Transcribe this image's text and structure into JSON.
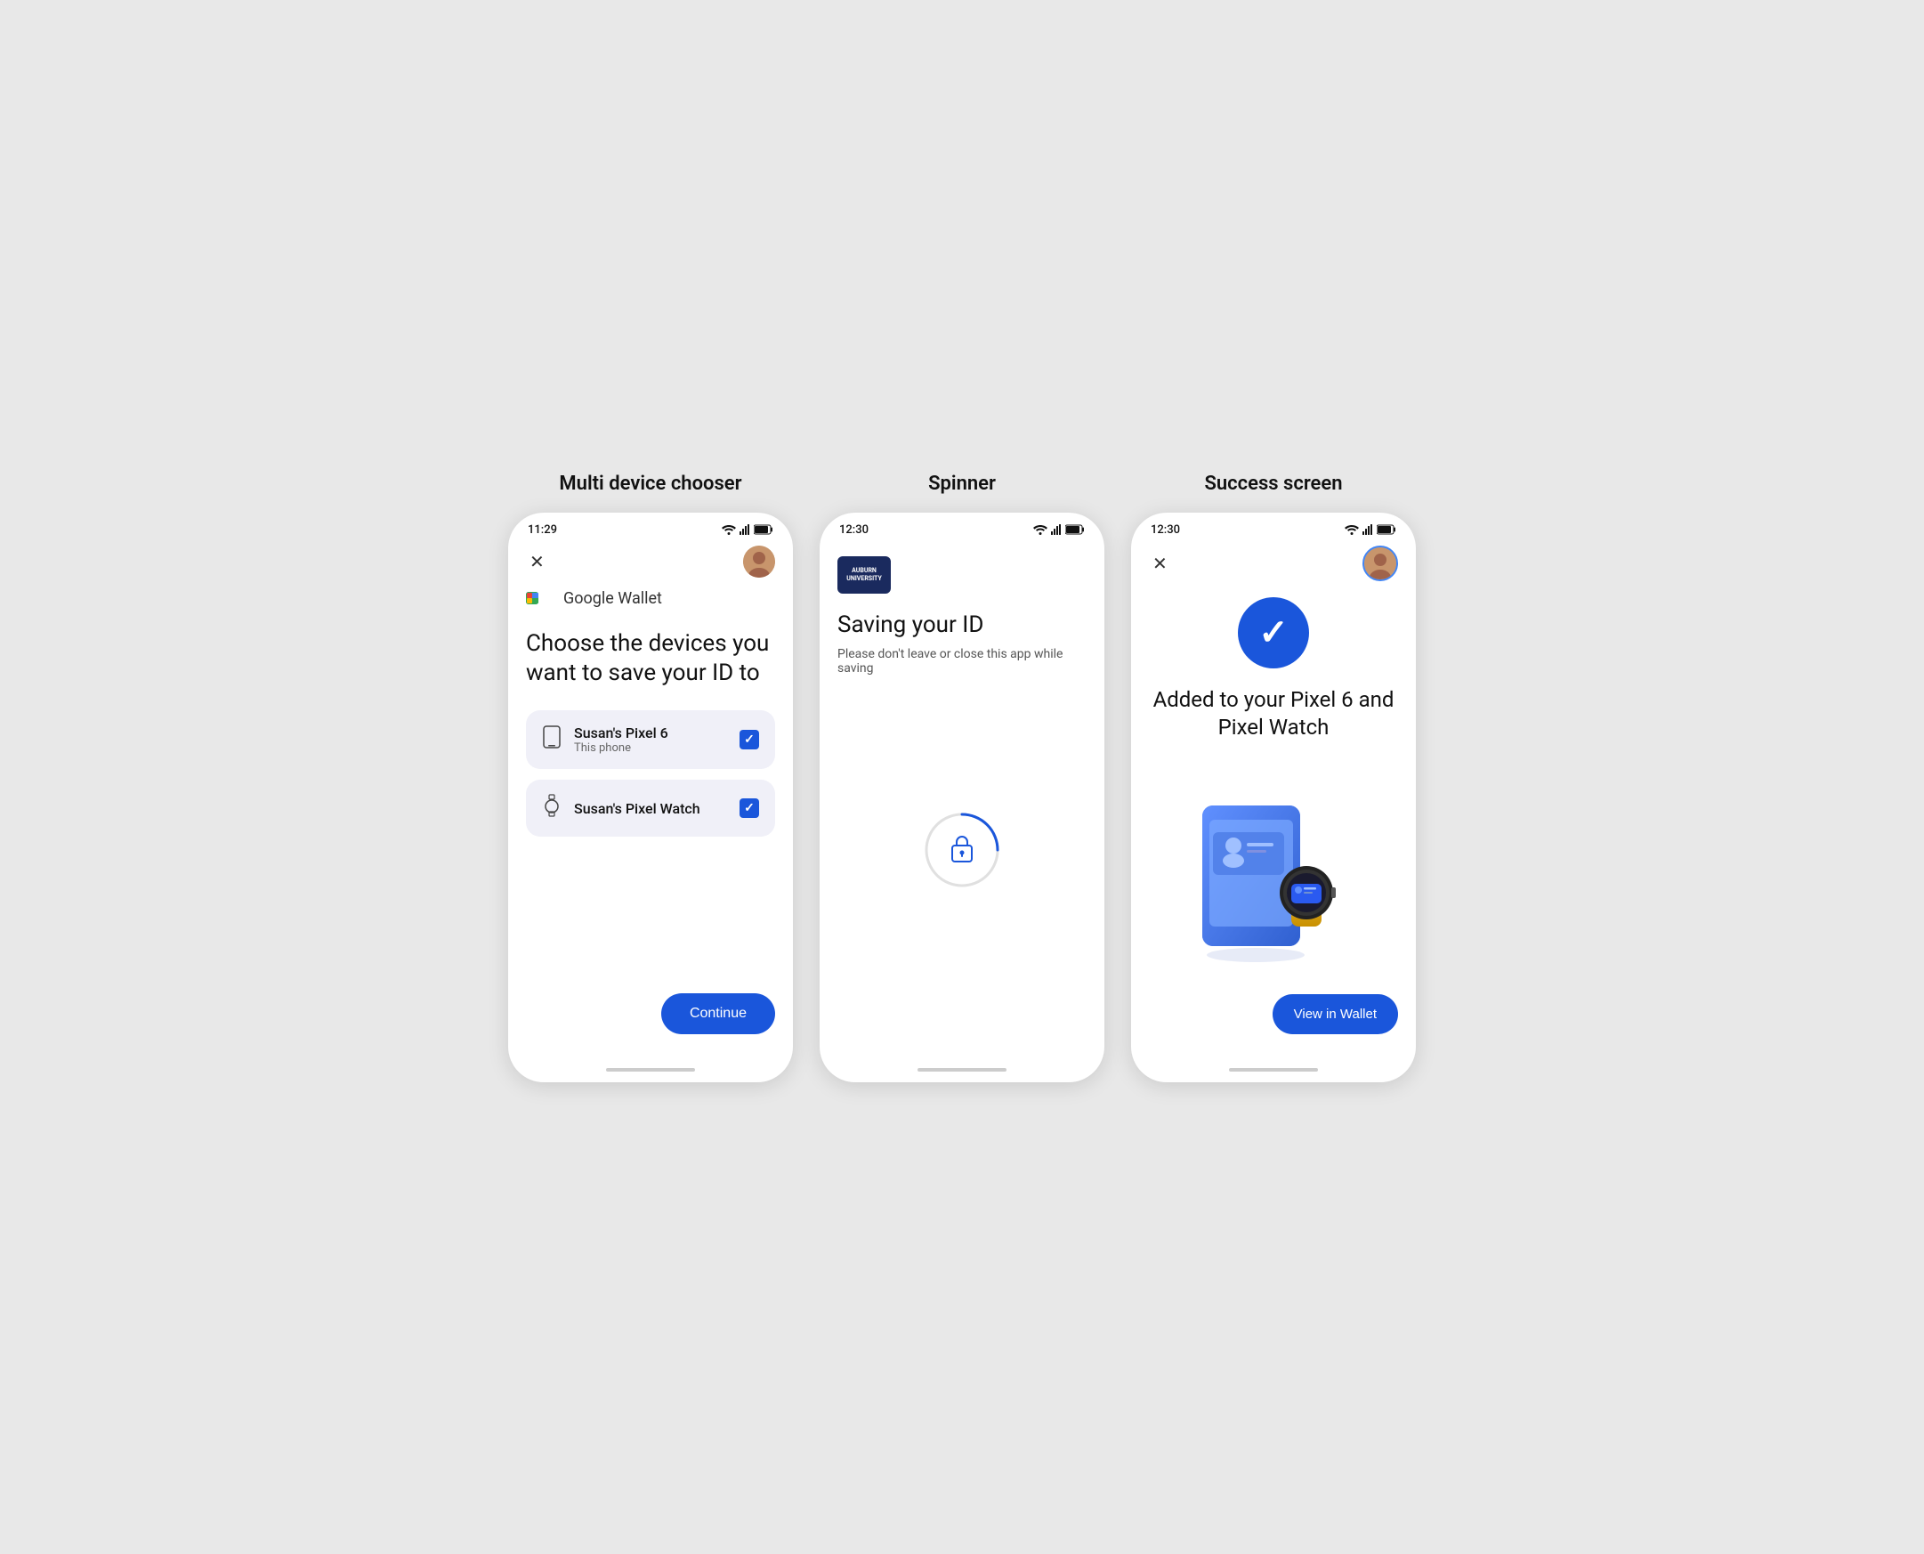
{
  "page": {
    "background": "#e8e8e8"
  },
  "screens": [
    {
      "id": "multi-device-chooser",
      "label": "Multi device chooser",
      "statusBar": {
        "time": "11:29"
      },
      "walletLogo": "Google Wallet",
      "title": "Choose the devices you want to save your ID to",
      "devices": [
        {
          "name": "Susan's Pixel 6",
          "sub": "This phone",
          "icon": "📱",
          "checked": true
        },
        {
          "name": "Susan's Pixel Watch",
          "sub": "",
          "icon": "⌚",
          "checked": true
        }
      ],
      "continueLabel": "Continue"
    },
    {
      "id": "spinner",
      "label": "Spinner",
      "statusBar": {
        "time": "12:30"
      },
      "institutionName": "AUBURN UNIVERSITY",
      "title": "Saving your ID",
      "subtitle": "Please don't leave or close this app while saving"
    },
    {
      "id": "success-screen",
      "label": "Success screen",
      "statusBar": {
        "time": "12:30"
      },
      "title": "Added to your Pixel 6 and Pixel Watch",
      "viewWalletLabel": "View in Wallet"
    }
  ]
}
